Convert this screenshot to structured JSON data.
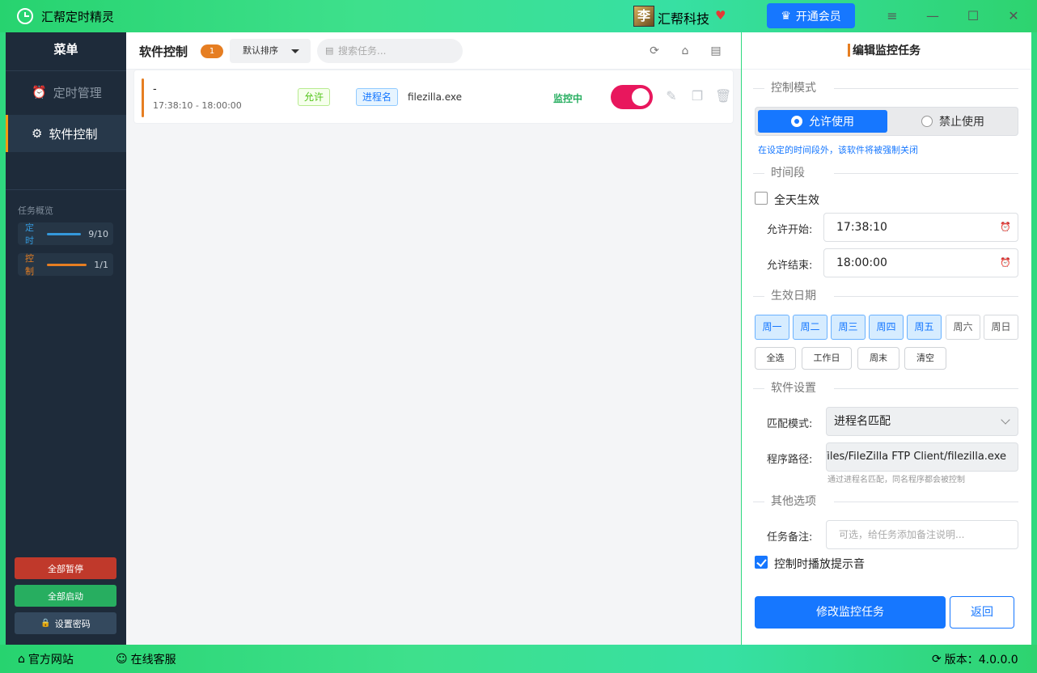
{
  "app": {
    "title": "汇帮定时精灵",
    "brand_logo": "李",
    "brand_name": "汇帮科技",
    "vip_label": "开通会员"
  },
  "sidebar": {
    "menu_title": "菜单",
    "items": [
      {
        "label": "定时管理",
        "icon": "alarm-clock-icon",
        "active": false
      },
      {
        "label": "软件控制",
        "icon": "gear-icon",
        "active": true
      }
    ],
    "overview_label": "任务概览",
    "stats": [
      {
        "label": "定时",
        "value": "9/10",
        "color": "#3498db",
        "fill": 0.9
      },
      {
        "label": "控制",
        "value": "1/1",
        "color": "#e67e22",
        "fill": 1.0
      }
    ],
    "buttons": {
      "pause_all": "全部暂停",
      "start_all": "全部启动",
      "set_password": "设置密码"
    }
  },
  "main": {
    "title": "软件控制",
    "count": "1",
    "sort": "默认排序",
    "search_placeholder": "搜索任务...",
    "task": {
      "name": "-",
      "time": "17:38:10 - 18:00:00",
      "mode_tag": "允许",
      "match_tag": "进程名",
      "exe": "filezilla.exe",
      "status": "监控中",
      "enabled": true
    }
  },
  "panel": {
    "title": "编辑监控任务",
    "sections": {
      "mode": "控制模式",
      "time": "时间段",
      "days": "生效日期",
      "software": "软件设置",
      "other": "其他选项"
    },
    "mode": {
      "allow": "允许使用",
      "deny": "禁止使用",
      "selected": "allow",
      "hint": "在设定的时间段外，该软件将被强制关闭"
    },
    "all_day": {
      "label": "全天生效",
      "checked": false
    },
    "start": {
      "label": "允许开始:",
      "value": "17:38:10"
    },
    "end": {
      "label": "允许结束:",
      "value": "18:00:00"
    },
    "days": [
      {
        "label": "周一",
        "on": true
      },
      {
        "label": "周二",
        "on": true
      },
      {
        "label": "周三",
        "on": true
      },
      {
        "label": "周四",
        "on": true
      },
      {
        "label": "周五",
        "on": true
      },
      {
        "label": "周六",
        "on": false
      },
      {
        "label": "周日",
        "on": false
      }
    ],
    "quick": {
      "all": "全选",
      "workday": "工作日",
      "weekend": "周末",
      "clear": "清空"
    },
    "match": {
      "label": "匹配模式:",
      "value": "进程名匹配"
    },
    "path": {
      "label": "程序路径:",
      "value": "C:/Program Files/FileZilla FTP Client/filezilla.exe",
      "hint": "通过进程名匹配，同名程序都会被控制"
    },
    "note": {
      "label": "任务备注:",
      "placeholder": "可选，给任务添加备注说明..."
    },
    "sound": {
      "label": "控制时播放提示音",
      "checked": true
    },
    "submit": "修改监控任务",
    "back": "返回"
  },
  "footer": {
    "website": "官方网站",
    "service": "在线客服",
    "version": "版本：4.0.0.0"
  }
}
